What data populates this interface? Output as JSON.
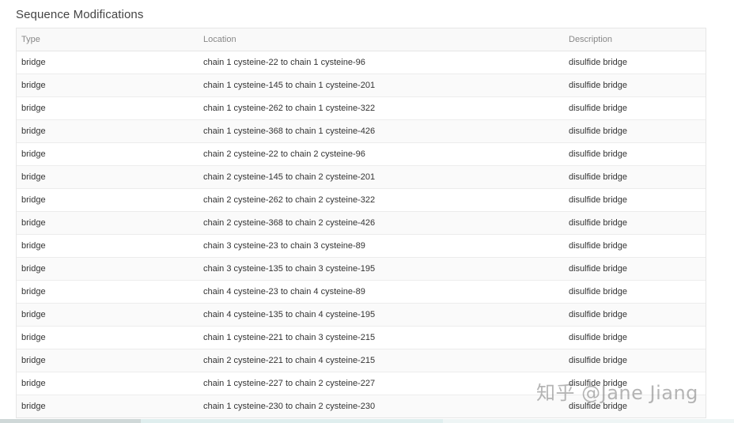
{
  "section": {
    "title": "Sequence Modifications"
  },
  "table": {
    "headers": {
      "type": "Type",
      "location": "Location",
      "description": "Description"
    },
    "rows": [
      {
        "type": "bridge",
        "location": "chain 1 cysteine-22 to chain 1 cysteine-96",
        "description": "disulfide bridge"
      },
      {
        "type": "bridge",
        "location": "chain 1 cysteine-145 to chain 1 cysteine-201",
        "description": "disulfide bridge"
      },
      {
        "type": "bridge",
        "location": "chain 1 cysteine-262 to chain 1 cysteine-322",
        "description": "disulfide bridge"
      },
      {
        "type": "bridge",
        "location": "chain 1 cysteine-368 to chain 1 cysteine-426",
        "description": "disulfide bridge"
      },
      {
        "type": "bridge",
        "location": "chain 2 cysteine-22 to chain 2 cysteine-96",
        "description": "disulfide bridge"
      },
      {
        "type": "bridge",
        "location": "chain 2 cysteine-145 to chain 2 cysteine-201",
        "description": "disulfide bridge"
      },
      {
        "type": "bridge",
        "location": "chain 2 cysteine-262 to chain 2 cysteine-322",
        "description": "disulfide bridge"
      },
      {
        "type": "bridge",
        "location": "chain 2 cysteine-368 to chain 2 cysteine-426",
        "description": "disulfide bridge"
      },
      {
        "type": "bridge",
        "location": "chain 3 cysteine-23 to chain 3 cysteine-89",
        "description": "disulfide bridge"
      },
      {
        "type": "bridge",
        "location": "chain 3 cysteine-135 to chain 3 cysteine-195",
        "description": "disulfide bridge"
      },
      {
        "type": "bridge",
        "location": "chain 4 cysteine-23 to chain 4 cysteine-89",
        "description": "disulfide bridge"
      },
      {
        "type": "bridge",
        "location": "chain 4 cysteine-135 to chain 4 cysteine-195",
        "description": "disulfide bridge"
      },
      {
        "type": "bridge",
        "location": "chain 1 cysteine-221 to chain 3 cysteine-215",
        "description": "disulfide bridge"
      },
      {
        "type": "bridge",
        "location": "chain 2 cysteine-221 to chain 4 cysteine-215",
        "description": "disulfide bridge"
      },
      {
        "type": "bridge",
        "location": "chain 1 cysteine-227 to chain 2 cysteine-227",
        "description": "disulfide bridge"
      },
      {
        "type": "bridge",
        "location": "chain 1 cysteine-230 to chain 2 cysteine-230",
        "description": "disulfide bridge"
      }
    ]
  },
  "watermark": {
    "text": "知乎 @Jane Jiang"
  }
}
